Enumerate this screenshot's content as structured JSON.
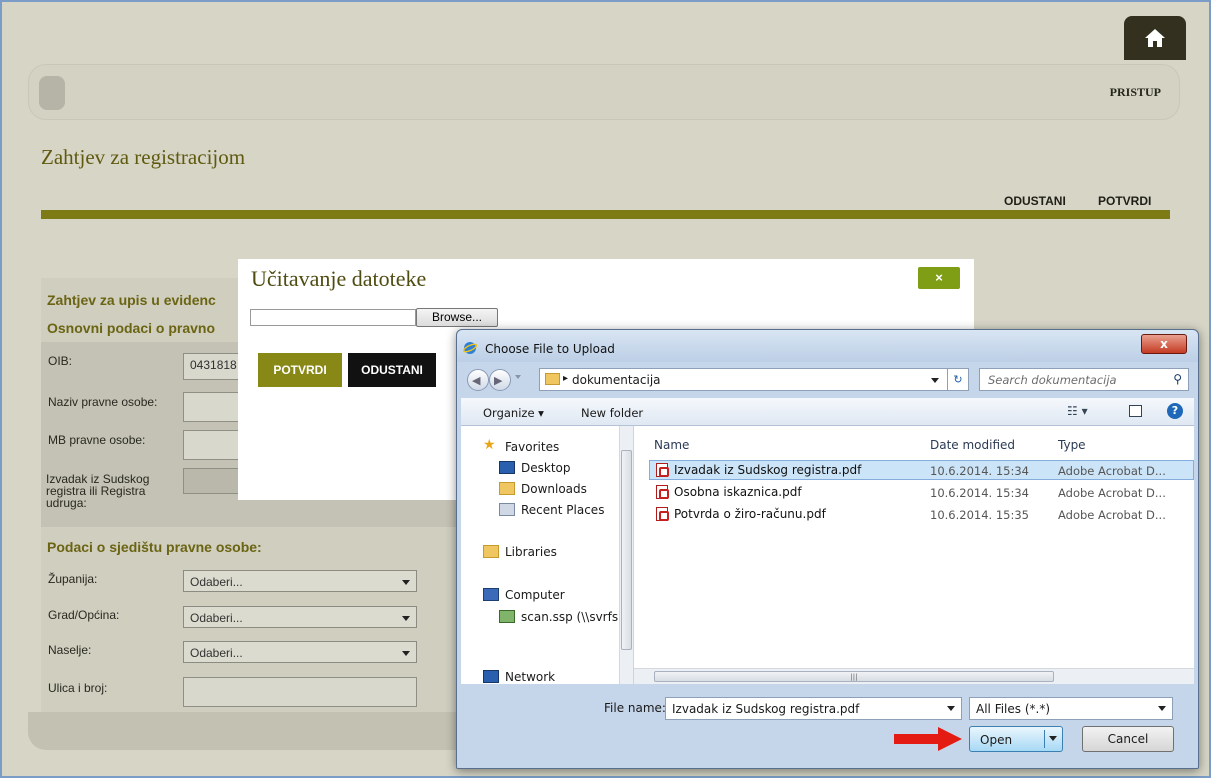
{
  "header": {
    "pristup_label": "PRISTUP"
  },
  "page": {
    "title": "Zahtjev za registracijom",
    "actions": {
      "odustani": "ODUSTANI",
      "potvrdi": "POTVRDI"
    }
  },
  "form": {
    "section1": "Zahtjev za upis u evidenc",
    "section2": "Osnovni podaci o pravno",
    "oib_label": "OIB:",
    "oib_value": "0431818",
    "naziv_label": "Naziv pravne osobe:",
    "mb_label": "MB pravne osobe:",
    "izvadak_label": "Izvadak iz Sudskog registra ili Registra udruga:",
    "section3": "Podaci o sjedištu pravne osobe:",
    "zupanija_label": "Županija:",
    "grad_label": "Grad/Općina:",
    "naselje_label": "Naselje:",
    "ulica_label": "Ulica i broj:",
    "select_placeholder": "Odaberi..."
  },
  "upload_modal": {
    "title": "Učitavanje datoteke",
    "close_label": "×",
    "browse_label": "Browse...",
    "potvrdi_label": "POTVRDI",
    "odustani_label": "ODUSTANI"
  },
  "file_dialog": {
    "title": "Choose File to Upload",
    "close_label": "x",
    "address_path": "dokumentacija",
    "search_placeholder": "Search dokumentacija",
    "toolbar": {
      "organize": "Organize ▾",
      "new_folder": "New folder"
    },
    "nav": {
      "favorites": "Favorites",
      "desktop": "Desktop",
      "downloads": "Downloads",
      "recent_places": "Recent Places",
      "libraries": "Libraries",
      "computer": "Computer",
      "scan": "scan.ssp (\\\\svrfs)",
      "network": "Network"
    },
    "columns": {
      "name": "Name",
      "date_modified": "Date modified",
      "type": "Type"
    },
    "files": [
      {
        "name": "Izvadak iz Sudskog registra.pdf",
        "date": "10.6.2014. 15:34",
        "type": "Adobe Acrobat D..."
      },
      {
        "name": "Osobna iskaznica.pdf",
        "date": "10.6.2014. 15:34",
        "type": "Adobe Acrobat D..."
      },
      {
        "name": "Potvrda o žiro-računu.pdf",
        "date": "10.6.2014. 15:35",
        "type": "Adobe Acrobat D..."
      }
    ],
    "file_name_label": "File name:",
    "file_name_value": "Izvadak iz Sudskog registra.pdf",
    "file_type_value": "All Files (*.*)",
    "open_label": "Open",
    "cancel_label": "Cancel"
  },
  "colors": {
    "olive": "#7d7b16",
    "accent_green": "#7f9e15",
    "arrow_red": "#e41b12"
  }
}
